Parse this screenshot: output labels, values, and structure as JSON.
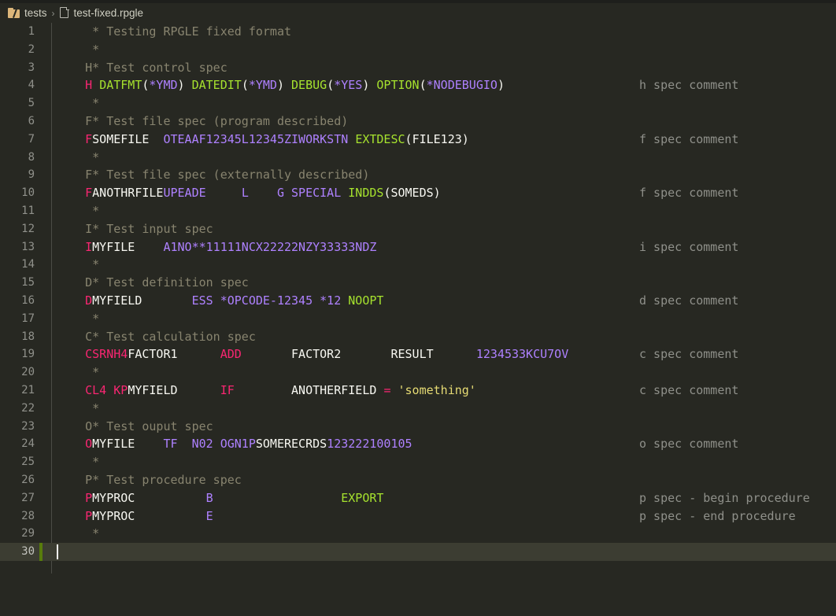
{
  "window": {
    "title": "test-fixed.rpgle"
  },
  "breadcrumb": {
    "folder": "tests",
    "separator": "›",
    "file": "test-fixed.rpgle",
    "folder_icon": "folder-icon",
    "file_icon": "file-icon"
  },
  "editor": {
    "language": "RPGLE fixed format",
    "total_lines": 30,
    "current_line": 30,
    "cursor_column": 1,
    "colors": {
      "background": "#272822",
      "current_line": "#3c3d32",
      "comment": "#88846f",
      "spec_letter": "#f92672",
      "keyword": "#a6e22e",
      "constant": "#ae81ff",
      "plain": "#f8f8f2",
      "string": "#e6db74",
      "operator": "#f92672",
      "line_number": "#90918b",
      "change_bar_added": "#587c0c",
      "cursor": "#f8f8f0"
    },
    "lines": [
      {
        "n": 1,
        "trail": "",
        "tokens": [
          {
            "t": "cmt",
            "s": "     * Testing RPGLE fixed format"
          }
        ]
      },
      {
        "n": 2,
        "trail": "",
        "tokens": [
          {
            "t": "cmt",
            "s": "     *"
          }
        ]
      },
      {
        "n": 3,
        "trail": "",
        "tokens": [
          {
            "t": "cmt",
            "s": "    H* Test control spec"
          }
        ]
      },
      {
        "n": 4,
        "trail": "h spec comment",
        "tokens": [
          {
            "t": "spec",
            "s": "    H"
          },
          {
            "t": "plain",
            "s": " "
          },
          {
            "t": "kw",
            "s": "DATFMT"
          },
          {
            "t": "punc",
            "s": "("
          },
          {
            "t": "num",
            "s": "*YMD"
          },
          {
            "t": "punc",
            "s": ") "
          },
          {
            "t": "kw",
            "s": "DATEDIT"
          },
          {
            "t": "punc",
            "s": "("
          },
          {
            "t": "num",
            "s": "*YMD"
          },
          {
            "t": "punc",
            "s": ") "
          },
          {
            "t": "kw",
            "s": "DEBUG"
          },
          {
            "t": "punc",
            "s": "("
          },
          {
            "t": "num",
            "s": "*YES"
          },
          {
            "t": "punc",
            "s": ") "
          },
          {
            "t": "kw",
            "s": "OPTION"
          },
          {
            "t": "punc",
            "s": "("
          },
          {
            "t": "num",
            "s": "*NODEBUGIO"
          },
          {
            "t": "punc",
            "s": ")"
          }
        ]
      },
      {
        "n": 5,
        "trail": "",
        "tokens": [
          {
            "t": "cmt",
            "s": "     *"
          }
        ]
      },
      {
        "n": 6,
        "trail": "",
        "tokens": [
          {
            "t": "cmt",
            "s": "    F* Test file spec (program described)"
          }
        ]
      },
      {
        "n": 7,
        "trail": "f spec comment",
        "tokens": [
          {
            "t": "spec",
            "s": "    F"
          },
          {
            "t": "plain",
            "s": "SOMEFILE  "
          },
          {
            "t": "num",
            "s": "OTEAAF12345L12345ZIWORKSTN"
          },
          {
            "t": "plain",
            "s": " "
          },
          {
            "t": "kw",
            "s": "EXTDESC"
          },
          {
            "t": "punc",
            "s": "("
          },
          {
            "t": "plain",
            "s": "FILE123"
          },
          {
            "t": "punc",
            "s": ")"
          }
        ]
      },
      {
        "n": 8,
        "trail": "",
        "tokens": [
          {
            "t": "cmt",
            "s": "     *"
          }
        ]
      },
      {
        "n": 9,
        "trail": "",
        "tokens": [
          {
            "t": "cmt",
            "s": "    F* Test file spec (externally described)"
          }
        ]
      },
      {
        "n": 10,
        "trail": "f spec comment",
        "tokens": [
          {
            "t": "spec",
            "s": "    F"
          },
          {
            "t": "plain",
            "s": "ANOTHRFILE"
          },
          {
            "t": "num",
            "s": "UPEADE"
          },
          {
            "t": "plain",
            "s": "     "
          },
          {
            "t": "num",
            "s": "L"
          },
          {
            "t": "plain",
            "s": "    "
          },
          {
            "t": "num",
            "s": "G SPECIAL"
          },
          {
            "t": "plain",
            "s": " "
          },
          {
            "t": "kw",
            "s": "INDDS"
          },
          {
            "t": "punc",
            "s": "(SOMEDS)"
          }
        ]
      },
      {
        "n": 11,
        "trail": "",
        "tokens": [
          {
            "t": "cmt",
            "s": "     *"
          }
        ]
      },
      {
        "n": 12,
        "trail": "",
        "tokens": [
          {
            "t": "cmt",
            "s": "    I* Test input spec"
          }
        ]
      },
      {
        "n": 13,
        "trail": "i spec comment",
        "tokens": [
          {
            "t": "spec",
            "s": "    I"
          },
          {
            "t": "plain",
            "s": "MYFILE    "
          },
          {
            "t": "num",
            "s": "A1NO**11111NCX22222NZY33333NDZ"
          }
        ]
      },
      {
        "n": 14,
        "trail": "",
        "tokens": [
          {
            "t": "cmt",
            "s": "     *"
          }
        ]
      },
      {
        "n": 15,
        "trail": "",
        "tokens": [
          {
            "t": "cmt",
            "s": "    D* Test definition spec"
          }
        ]
      },
      {
        "n": 16,
        "trail": "d spec comment",
        "tokens": [
          {
            "t": "spec",
            "s": "    D"
          },
          {
            "t": "plain",
            "s": "MYFIELD       "
          },
          {
            "t": "num",
            "s": "ESS *OPCODE-12345 *12"
          },
          {
            "t": "plain",
            "s": " "
          },
          {
            "t": "kw",
            "s": "NOOPT"
          }
        ]
      },
      {
        "n": 17,
        "trail": "",
        "tokens": [
          {
            "t": "cmt",
            "s": "     *"
          }
        ]
      },
      {
        "n": 18,
        "trail": "",
        "tokens": [
          {
            "t": "cmt",
            "s": "    C* Test calculation spec"
          }
        ]
      },
      {
        "n": 19,
        "trail": "c spec comment",
        "tokens": [
          {
            "t": "spec",
            "s": "    CSRNH4"
          },
          {
            "t": "plain",
            "s": "FACTOR1"
          },
          {
            "t": "plain",
            "s": "      "
          },
          {
            "t": "spec",
            "s": "ADD"
          },
          {
            "t": "plain",
            "s": "       FACTOR2       RESULT      "
          },
          {
            "t": "num",
            "s": "1234533KCU7OV"
          }
        ]
      },
      {
        "n": 20,
        "trail": "",
        "tokens": [
          {
            "t": "cmt",
            "s": "     *"
          }
        ]
      },
      {
        "n": 21,
        "trail": "c spec comment",
        "tokens": [
          {
            "t": "spec",
            "s": "    CL4 KP"
          },
          {
            "t": "plain",
            "s": "MYFIELD"
          },
          {
            "t": "plain",
            "s": "      "
          },
          {
            "t": "spec",
            "s": "IF"
          },
          {
            "t": "plain",
            "s": "        ANOTHERFIELD "
          },
          {
            "t": "op",
            "s": "="
          },
          {
            "t": "plain",
            "s": " "
          },
          {
            "t": "str",
            "s": "'something'"
          }
        ]
      },
      {
        "n": 22,
        "trail": "",
        "tokens": [
          {
            "t": "cmt",
            "s": "     *"
          }
        ]
      },
      {
        "n": 23,
        "trail": "",
        "tokens": [
          {
            "t": "cmt",
            "s": "    O* Test ouput spec"
          }
        ]
      },
      {
        "n": 24,
        "trail": "o spec comment",
        "tokens": [
          {
            "t": "spec",
            "s": "    O"
          },
          {
            "t": "plain",
            "s": "MYFILE    "
          },
          {
            "t": "num",
            "s": "TF"
          },
          {
            "t": "plain",
            "s": "  "
          },
          {
            "t": "num",
            "s": "N02 OGN1P"
          },
          {
            "t": "plain",
            "s": "SOMERECRDS"
          },
          {
            "t": "num",
            "s": "123222100105"
          }
        ]
      },
      {
        "n": 25,
        "trail": "",
        "tokens": [
          {
            "t": "cmt",
            "s": "     *"
          }
        ]
      },
      {
        "n": 26,
        "trail": "",
        "tokens": [
          {
            "t": "cmt",
            "s": "    P* Test procedure spec"
          }
        ]
      },
      {
        "n": 27,
        "trail": "p spec - begin procedure",
        "tokens": [
          {
            "t": "spec",
            "s": "    P"
          },
          {
            "t": "plain",
            "s": "MYPROC"
          },
          {
            "t": "plain",
            "s": "          "
          },
          {
            "t": "num",
            "s": "B"
          },
          {
            "t": "plain",
            "s": "                  "
          },
          {
            "t": "kw",
            "s": "EXPORT"
          }
        ]
      },
      {
        "n": 28,
        "trail": "p spec - end procedure",
        "tokens": [
          {
            "t": "spec",
            "s": "    P"
          },
          {
            "t": "plain",
            "s": "MYPROC"
          },
          {
            "t": "plain",
            "s": "          "
          },
          {
            "t": "num",
            "s": "E"
          }
        ]
      },
      {
        "n": 29,
        "trail": "",
        "tokens": [
          {
            "t": "cmt",
            "s": "     *"
          }
        ]
      },
      {
        "n": 30,
        "trail": "",
        "tokens": []
      }
    ]
  }
}
